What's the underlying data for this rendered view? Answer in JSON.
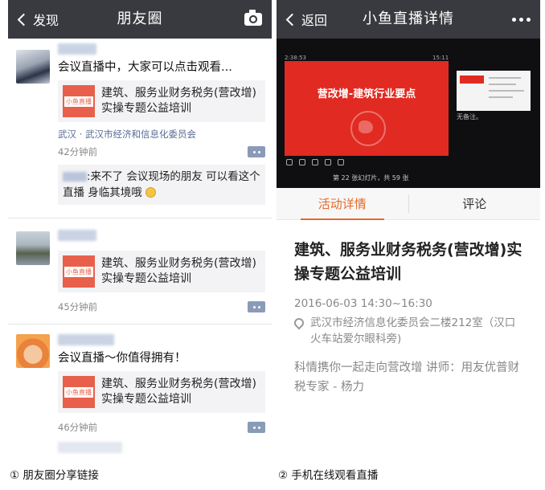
{
  "moments": {
    "nav": {
      "back_label": "发现",
      "title": "朋友圈",
      "camera_icon": "camera-icon"
    },
    "card_title": "建筑、服务业财务税务(营改增)实操专题公益培训",
    "card_thumb_text": "小鱼直播",
    "posts": [
      {
        "text": "会议直播中，大家可以点击观看...",
        "location": "武汉 · 武汉市经济和信息化委员会",
        "time": "42分钟前",
        "comment": ":来不了 会议现场的朋友 可以看这个直播 身临其境哦"
      },
      {
        "text": "",
        "time": "45分钟前"
      },
      {
        "text": "会议直播～你值得拥有！",
        "time": "46分钟前"
      }
    ]
  },
  "live": {
    "nav": {
      "back_label": "返回",
      "title": "小鱼直播详情"
    },
    "slide": {
      "title": "营改增-建筑行业要点",
      "side_label": "无备注。",
      "top_left": "2:38:53",
      "top_right": "15:11",
      "pager": "第 22 张幻灯片，共 59 张"
    },
    "tabs": [
      {
        "label": "活动详情",
        "active": true
      },
      {
        "label": "评论",
        "active": false
      }
    ],
    "event": {
      "title": "建筑、服务业财务税务(营改增)实操专题公益培训",
      "time": "2016-06-03 14:30~16:30",
      "location": "武汉市经济信息化委员会二楼212室（汉口火车站爱尔眼科旁)",
      "description": "科情携你一起走向营改增 讲师：用友优普财税专家 - 杨力"
    },
    "accent_color": "#e7692a"
  },
  "captions": {
    "left": "① 朋友圈分享链接",
    "right": "② 手机在线观看直播"
  }
}
